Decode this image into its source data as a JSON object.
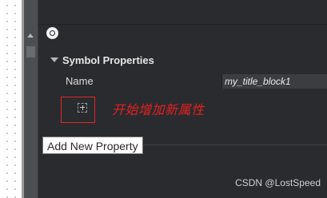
{
  "panel": {
    "toolbar": {
      "icon": "settings-icon"
    },
    "section": {
      "title": "Symbol Properties",
      "expanded": true,
      "icon": "collapse-caret-icon"
    },
    "fields": {
      "name_label": "Name",
      "name_value": "my_title_block1"
    },
    "add_property": {
      "icon": "add-property-icon",
      "tooltip": "Add New Property"
    }
  },
  "annotation": {
    "text": "开始增加新属性",
    "color": "#e62020"
  },
  "watermark": "CSDN @LostSpeed",
  "colors": {
    "panel_bg": "#2a2b2e",
    "highlight": "#e02828"
  }
}
